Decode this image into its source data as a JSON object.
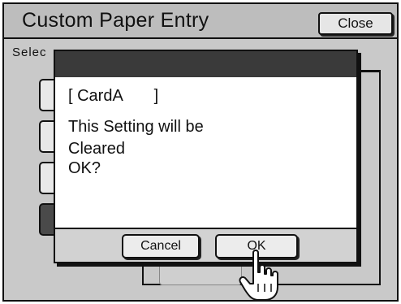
{
  "screen": {
    "title": "Custom Paper Entry",
    "close_label": "Close",
    "subtitle": "Selec"
  },
  "dialog": {
    "entry_name": "[ CardA       ]",
    "line1": "This Setting will be",
    "line2": "Cleared",
    "line3": "OK?",
    "cancel_label": "Cancel",
    "ok_label": "OK"
  },
  "icons": {
    "pointer": "hand-pointer-icon"
  },
  "colors": {
    "frame_bg": "#c9c9c9",
    "dialog_header": "#3a3a3a",
    "selected_button": "#4a4a4a"
  }
}
